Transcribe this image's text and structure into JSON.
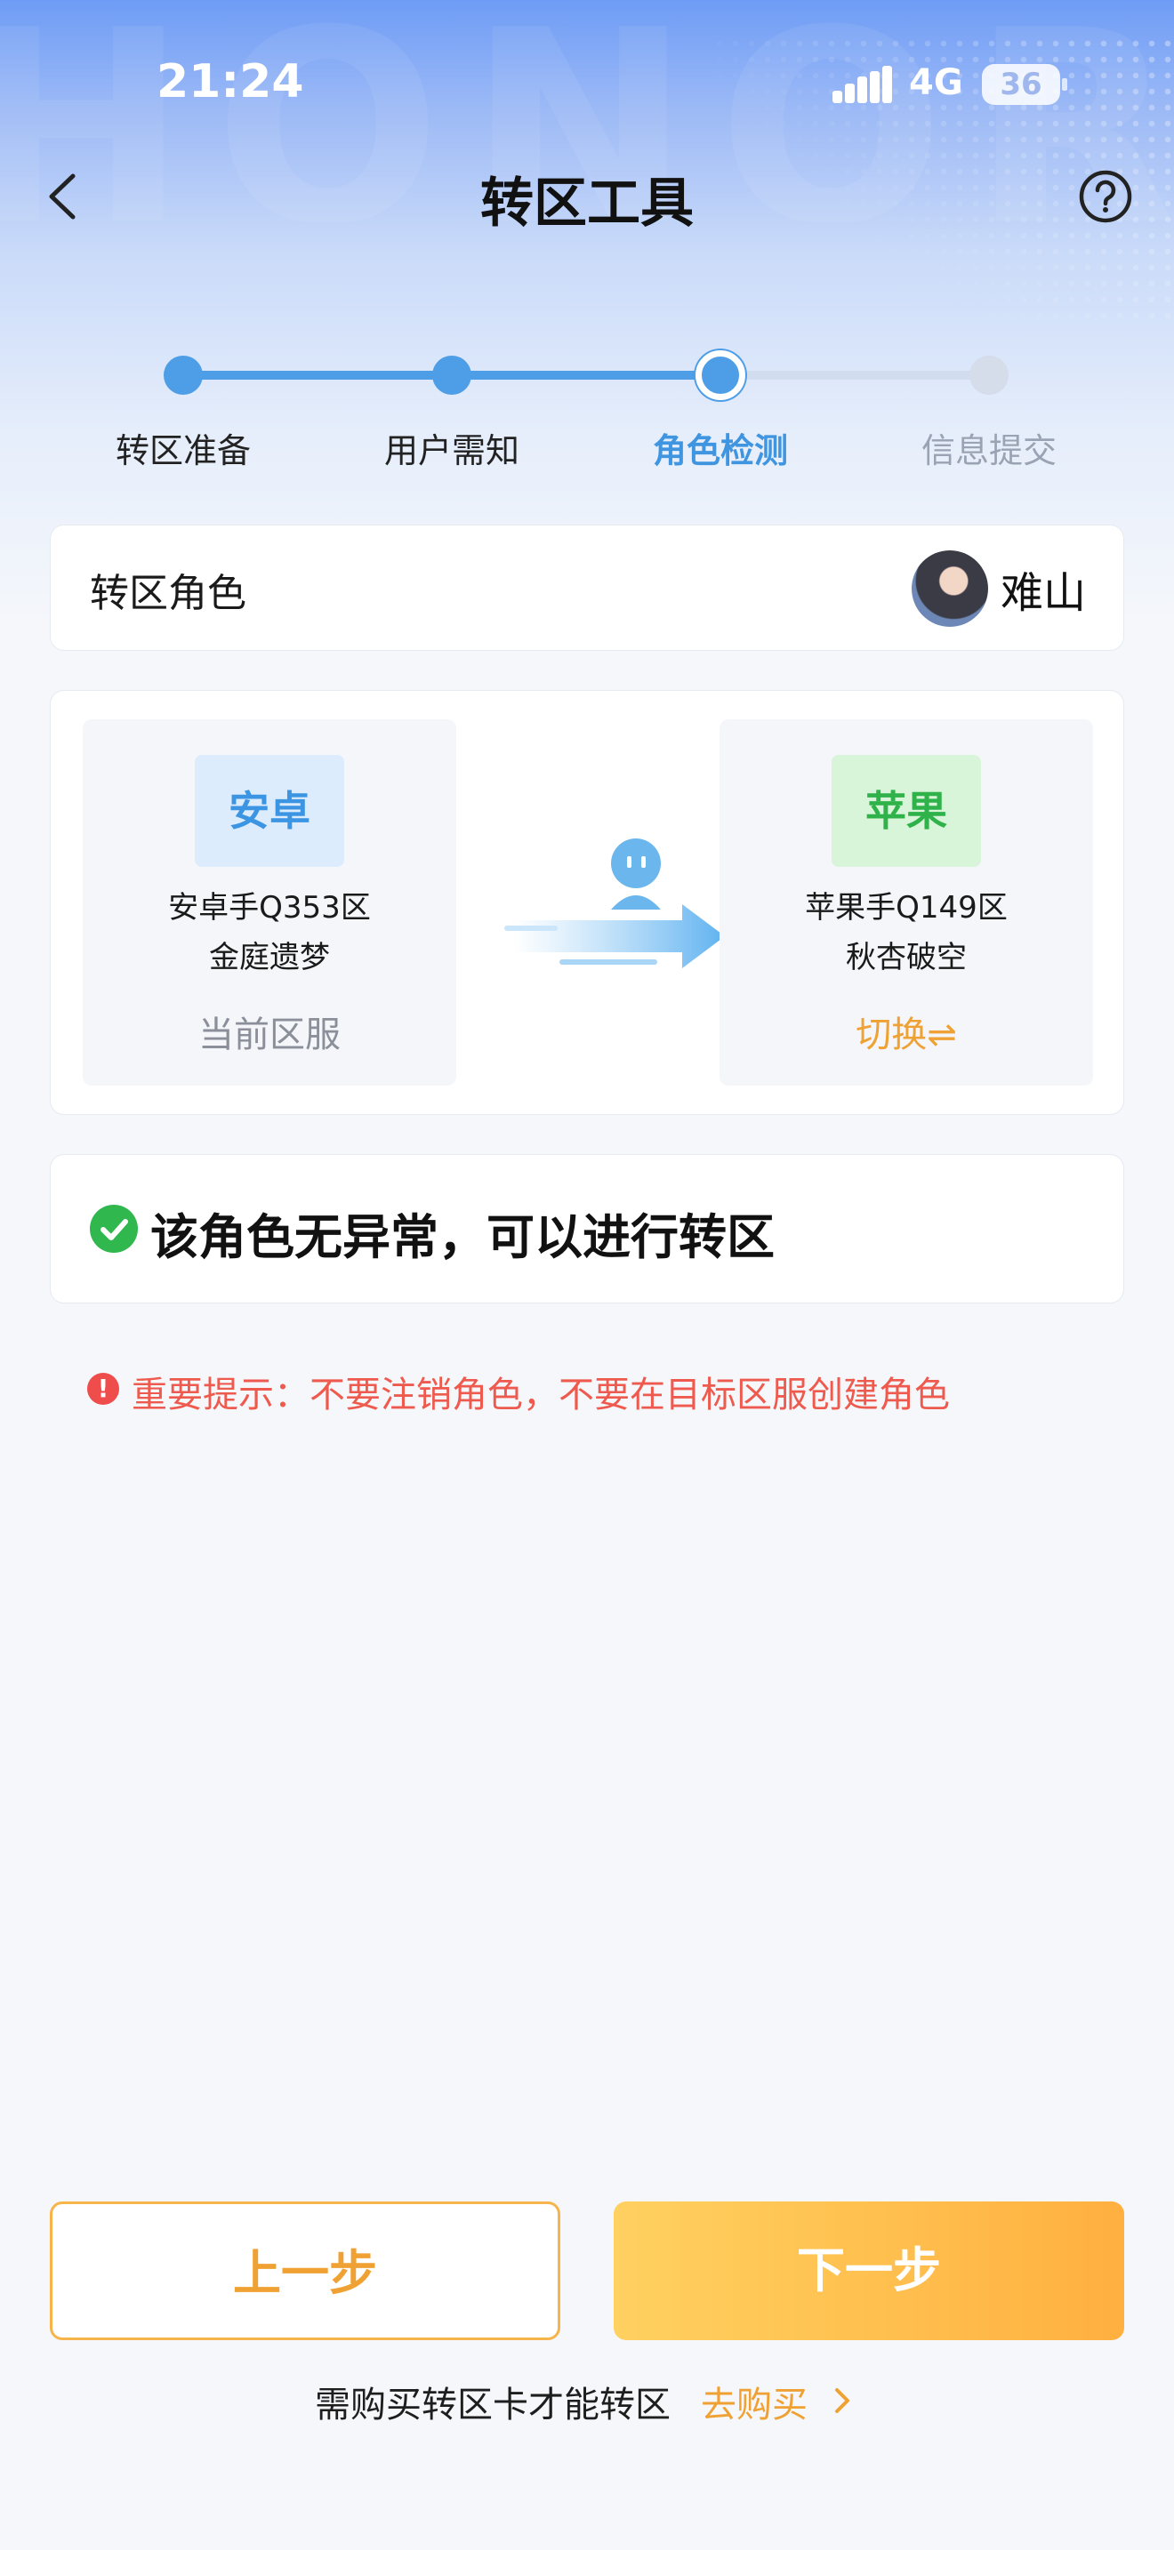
{
  "status_bar": {
    "time": "21:24",
    "network": "4G",
    "battery": "36"
  },
  "nav": {
    "title": "转区工具",
    "back_icon": "chevron-left-icon",
    "help_icon": "question-circle-icon"
  },
  "steps": [
    {
      "label": "转区准备",
      "state": "done"
    },
    {
      "label": "用户需知",
      "state": "done"
    },
    {
      "label": "角色检测",
      "state": "current"
    },
    {
      "label": "信息提交",
      "state": "todo"
    }
  ],
  "role": {
    "label": "转区角色",
    "name": "难山"
  },
  "source_server": {
    "platform": "安卓",
    "server": "安卓手Q353区",
    "character": "金庭遗梦",
    "status": "当前区服"
  },
  "target_server": {
    "platform": "苹果",
    "server": "苹果手Q149区",
    "character": "秋杏破空",
    "action": "切换⇌"
  },
  "check": {
    "message": "该角色无异常，可以进行转区",
    "icon": "check-circle-icon"
  },
  "warning": {
    "text": "重要提示：不要注销角色，不要在目标区服创建角色",
    "icon": "alert-circle-icon"
  },
  "buttons": {
    "prev": "上一步",
    "next": "下一步"
  },
  "footer": {
    "note": "需购买转区卡才能转区",
    "link": "去购买"
  },
  "colors": {
    "accent_blue": "#4d9ee6",
    "accent_orange": "#f0a133",
    "success_green": "#30b84e",
    "warning_red": "#ee5a4e"
  }
}
